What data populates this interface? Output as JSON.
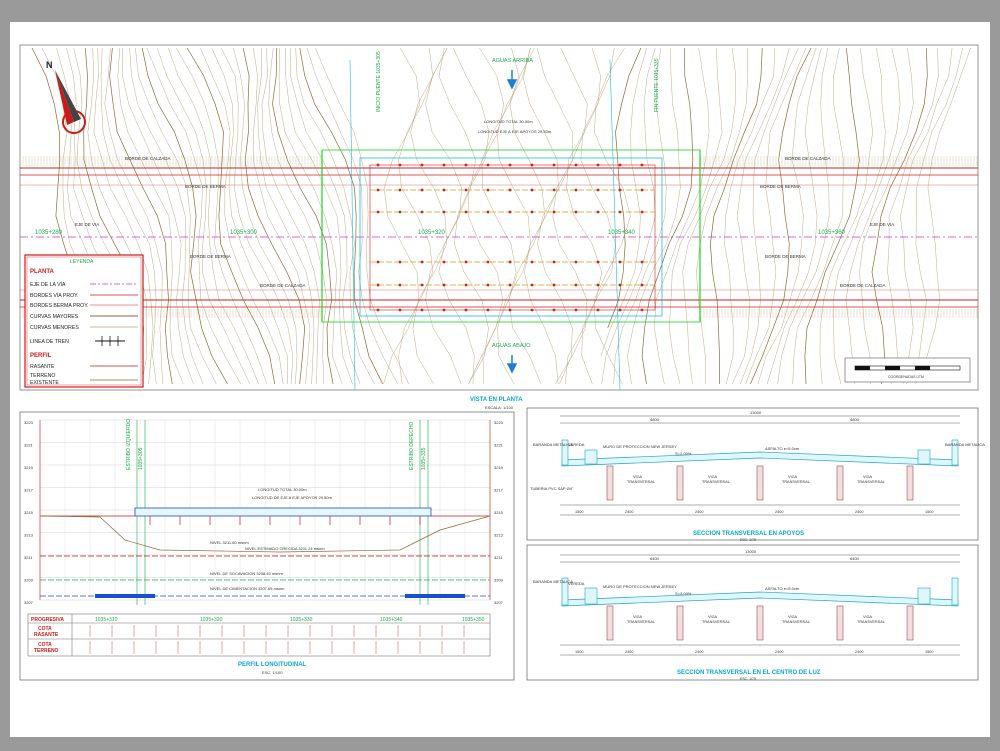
{
  "plan": {
    "title": "VISTA EN PLANTA",
    "scale": "ESCALA: 1/100",
    "aguas_arriba": "AGUAS ARRIBA",
    "aguas_abajo": "AGUAS ABAJO",
    "borde_calzada": "BORDE DE CALZADA",
    "borde_berma": "BORDE DE BERMA",
    "eje_via": "EJE DE VIA",
    "progressives": [
      "1035+280",
      "1035+300",
      "1035+320",
      "1035+340",
      "1035+360"
    ],
    "inicio": "INICIO PUENTE 1035+305",
    "fin": "FIN PUENTE 1035+335",
    "note1": "LONGITUD TOTAL 30.00m",
    "note2": "LONGITUD EJE A EJE APOYOS 29.50m",
    "scale_bar": "COORDENADAS UTM"
  },
  "legend": {
    "title": "LEYENDA",
    "planta": "PLANTA",
    "items": [
      "EJE DE LA VÍA",
      "BORDES VÍA PROY.",
      "BORDES BERMA PROY.",
      "CURVAS MAYORES",
      "CURVAS MENORES",
      "LINEA DE TREN"
    ],
    "perfil": "PERFIL",
    "perfil_items": [
      "RASANTE",
      "TERRENO\nEXISTENTE"
    ]
  },
  "profile": {
    "title": "PERFIL LONGITUDINAL",
    "scale": "ESC. 1/100",
    "y_left": [
      "3223",
      "3221",
      "3219",
      "3217",
      "3215",
      "3213",
      "3211",
      "3209",
      "3207"
    ],
    "y_right": [
      "3223",
      "3221",
      "3219",
      "3217",
      "3215",
      "3213",
      "3211",
      "3209",
      "3207"
    ],
    "row_labels": [
      "PROGRESIVA",
      "COTA\nRASANTE",
      "COTA\nTERRENO"
    ],
    "stations": [
      "1035+310",
      "1035+320",
      "1035+330",
      "1035+340",
      "1035+350"
    ],
    "estribo_left": "ESTRIBO IZQUIERDO\n1035+305",
    "estribo_right": "ESTRIBO DERECHO\n1035+335",
    "note_len": "LONGITUD TOTAL 30.00m",
    "note_axes": "LONGITUD DE EJE A EJE APOYOS 29.50m",
    "note_nivel1": "NIVEL 3211.80 msnm",
    "note_nivel2": "NIVEL ESTIMADO CRECIDA 3211.24 msnm",
    "note_nivel3": "NIVEL DE SOCAVACION 3208.40 msnm",
    "note_nivel4": "NIVEL DE CIMENTACION 3207.65 msnm"
  },
  "section_apoyos": {
    "title": "SECCION TRANSVERSAL EN APOYOS",
    "scale": "ESC. 1/75",
    "total": "13000",
    "dims_top": [
      "4800",
      "4800"
    ],
    "labels": [
      "BARANDA METALICA",
      "VEREDA",
      "MURO DE PROTECCION NEW JERSEY",
      "S=2.00%",
      "ASFALTO e=5.0cm",
      "VIGA TRANSVERSAL",
      "TUBERIA PVC SAP Ø4\"",
      "BARANDA METALICA",
      "VEREDA"
    ],
    "bottom_dims": [
      "1500",
      "2400",
      "2400",
      "2400",
      "2400",
      "1500"
    ]
  },
  "section_centro": {
    "title": "SECCION TRANSVERSAL EN EL CENTRO DE LUZ",
    "scale": "ESC. 1/75",
    "total": "13000",
    "dims_top": [
      "6400",
      "6400"
    ],
    "labels": [
      "BARANDA METALICA",
      "VEREDA",
      "MURO DE PROTECCION NEW JERSEY",
      "S=2.00%",
      "ASFALTO e=5.0cm",
      "VIGA TRANSVERSAL"
    ],
    "bottom_dims": [
      "1500",
      "2400",
      "2400",
      "2400",
      "2400",
      "1500"
    ]
  },
  "colors": {
    "background": "#9a9a9a",
    "sheet": "#ffffff",
    "contour_major": "#8b6b3a",
    "contour_minor": "#b8a27a",
    "road_edge": "#d41f1f",
    "axis": "#cc33cc",
    "label_green": "#1aa84b",
    "water_blue": "#1f7fd6",
    "deck": "#1fd6d6",
    "section_title": "#0aa7c9"
  }
}
